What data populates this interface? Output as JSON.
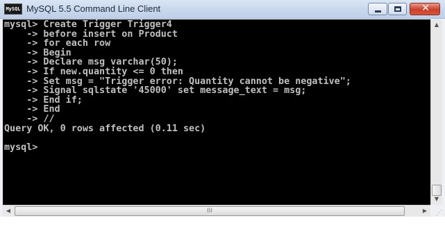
{
  "window": {
    "title": "MySQL 5.5 Command Line Client",
    "icon_text": "MySQL",
    "controls": {
      "minimize_icon": "minimize-icon",
      "maximize_icon": "maximize-icon",
      "close_glyph": "✕"
    }
  },
  "console": {
    "background": "#000000",
    "foreground": "#c0c0c0",
    "lines": [
      "mysql> Create Trigger Trigger4",
      "    -> before insert on Product",
      "    -> for each row",
      "    -> Begin",
      "    -> Declare msg varchar(50);",
      "    -> If new.quantity <= 0 then",
      "    -> Set msg = \"Trigger error: Quantity cannot be negative\";",
      "    -> Signal sqlstate '45000' set message_text = msg;",
      "    -> End if;",
      "    -> End",
      "    -> //",
      "Query OK, 0 rows affected (0.11 sec)",
      "",
      "mysql>"
    ]
  },
  "scrollbars": {
    "up_arrow": "▲",
    "down_arrow": "▼",
    "left_arrow": "◀",
    "right_arrow": "▶",
    "grip": "III",
    "resize": "⋰"
  }
}
